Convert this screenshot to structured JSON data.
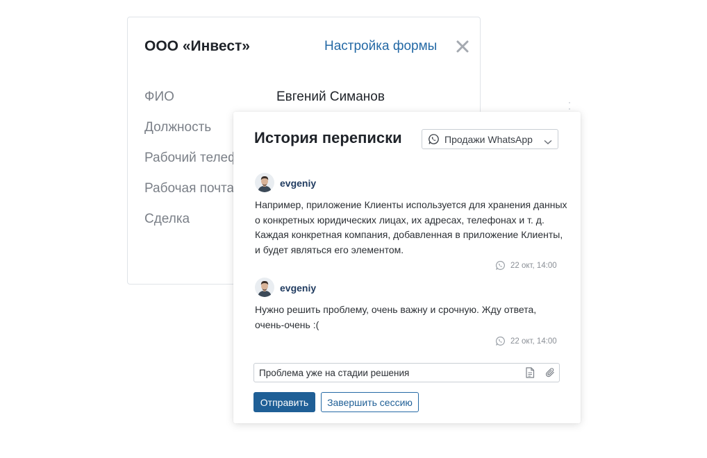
{
  "company_card": {
    "title": "ООО «Инвест»",
    "settings_link": "Настройка формы",
    "close_icon": "close-icon",
    "fields": [
      {
        "label": "ФИО",
        "value": "Евгений Симанов"
      },
      {
        "label": "Должность",
        "value": ""
      },
      {
        "label": "Рабочий телефон",
        "value": ""
      },
      {
        "label": "Рабочая почта",
        "value": ""
      },
      {
        "label": "Сделка",
        "value": ""
      }
    ]
  },
  "history": {
    "title": "История переписки",
    "channel": {
      "selected": "Продажи WhatsApp",
      "icon": "whatsapp-icon"
    },
    "messages": [
      {
        "author": "evgeniy",
        "lines": [
          "Например, приложение Клиенты используется для хранения данных",
          "о конкретных юридических лицах, их адресах, телефонах и т. д.",
          "Каждая конкретная компания, добавленная в приложение Клиенты,",
          "и будет являться его элементом."
        ],
        "time": "22 окт, 14:00"
      },
      {
        "author": "evgeniy",
        "lines": [
          "Нужно решить проблему, очень важну и срочную. Жду ответа,",
          "очень-очень  :("
        ],
        "time": "22 окт, 14:00"
      }
    ],
    "reply": {
      "value": "Проблема уже на стадии решения"
    },
    "send_button": "Отправить",
    "end_session_button": "Завершить сессию"
  },
  "colors": {
    "accent": "#1f5f96",
    "link": "#2469a5",
    "label_gray": "#7b8088"
  }
}
